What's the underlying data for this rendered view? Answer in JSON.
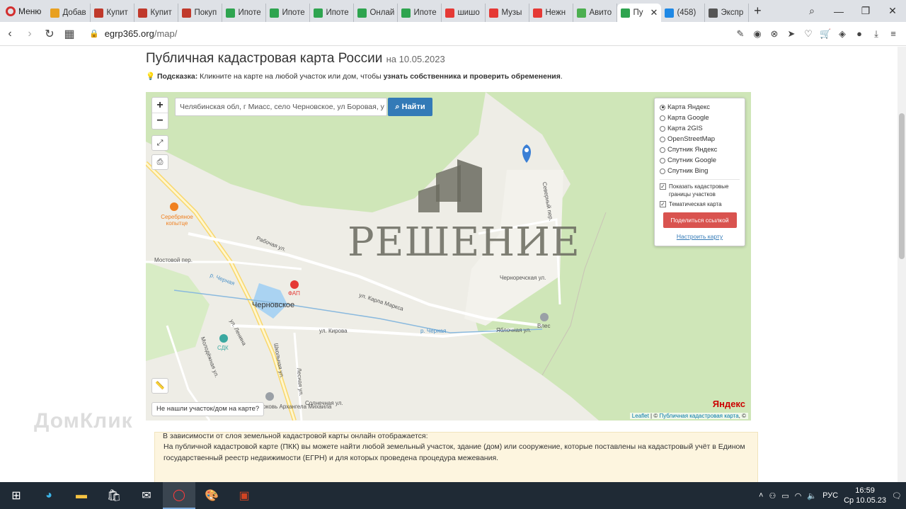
{
  "browser": {
    "menu_label": "Меню",
    "tabs": [
      {
        "label": "Добав",
        "color": "#e8a020"
      },
      {
        "label": "Купит",
        "color": "#c0392b"
      },
      {
        "label": "Купит",
        "color": "#c0392b"
      },
      {
        "label": "Покуп",
        "color": "#c0392b"
      },
      {
        "label": "Ипоте",
        "color": "#2ea44f"
      },
      {
        "label": "Ипоте",
        "color": "#2ea44f"
      },
      {
        "label": "Ипоте",
        "color": "#2ea44f"
      },
      {
        "label": "Онлай",
        "color": "#2ea44f"
      },
      {
        "label": "Ипоте",
        "color": "#2ea44f"
      },
      {
        "label": "шишо",
        "color": "#e53935"
      },
      {
        "label": "Музы",
        "color": "#e53935"
      },
      {
        "label": "Нежн",
        "color": "#e53935"
      },
      {
        "label": "Авито",
        "color": "#4caf50"
      },
      {
        "label": "Пу",
        "color": "#2ea44f",
        "active": true
      },
      {
        "label": "(458)",
        "color": "#1e88e5"
      },
      {
        "label": "Экспр",
        "color": "#555555"
      }
    ],
    "new_tab": "+",
    "url_domain": "egrp365.org",
    "url_path": "/map/"
  },
  "page": {
    "title": "Публичная кадастровая карта России",
    "title_date": "на 10.05.2023",
    "hint_label": "Подсказка:",
    "hint_text": "Кликните на карте на любой участок или дом, чтобы",
    "hint_bold": "узнать собственника и проверить обременения",
    "hint_end": "."
  },
  "map": {
    "search_value": "Челябинская обл, г Миасс, село Черновское, ул Боровая, у",
    "search_button": "Найти",
    "zoom_in": "+",
    "zoom_out": "−",
    "layers": [
      {
        "label": "Карта Яндекс",
        "selected": true
      },
      {
        "label": "Карта Google",
        "selected": false
      },
      {
        "label": "Карта 2GIS",
        "selected": false
      },
      {
        "label": "OpenStreetMap",
        "selected": false
      },
      {
        "label": "Спутник Яндекс",
        "selected": false
      },
      {
        "label": "Спутник Google",
        "selected": false
      },
      {
        "label": "Спутник Bing",
        "selected": false
      }
    ],
    "check_borders": "Показать кадастровые границы участков",
    "check_thematic": "Тематическая карта",
    "share_button": "Поделиться ссылкой",
    "configure_link": "Настроить карту",
    "not_found": "Не нашли участок/дом на карте?",
    "attribution_leaflet": "Leaflet",
    "attribution_pkk": "Публичная кадастровая карта",
    "attribution_sep": " | © ",
    "attribution_end": ", ©",
    "yandex_logo": "Яндекс",
    "watermark": "РЕШЕНИЕ",
    "labels": {
      "town": "Черновское",
      "poi_silver": "Серебряное копытце",
      "poi_fap": "ФАП",
      "poi_sdk": "СДК",
      "poi_vlec": "Влес",
      "poi_church": "Церковь Архангела Михаила",
      "st_rabochaya": "Рабочая ул.",
      "st_mostovoy": "Мостовой пер.",
      "st_karla": "ул. Карла Маркса",
      "st_kirova": "ул. Кирова",
      "st_lenina": "ул. Ленина",
      "st_molodezhnaya": "Молодёжная ул.",
      "st_shkolnaya": "Школьная ул.",
      "st_lesnaya": "Лесная ул.",
      "st_solnechnaya": "Солнечная ул.",
      "st_yablochnaya": "Яблочная ул.",
      "st_chernorech": "Черноречская ул.",
      "st_severny": "Северный пер.",
      "st_chernaya": "р. Черная",
      "st_chernaya2": "р. Черная"
    }
  },
  "info": {
    "text": "На публичной кадастровой карте (ПКК) вы можете найти любой земельный участок, здание (дом) или сооружение, которые поставлены на кадастровый учёт в Едином государственный реестр недвижимости (ЕГРН) и для которых проведена процедура межевания.",
    "more": "В зависимости от слоя земельной кадастровой карты онлайн отображается:"
  },
  "overlay": {
    "domclick": "ДомКлик"
  },
  "taskbar": {
    "lang": "РУС",
    "time": "16:59",
    "date": "Ср 10.05.23"
  }
}
